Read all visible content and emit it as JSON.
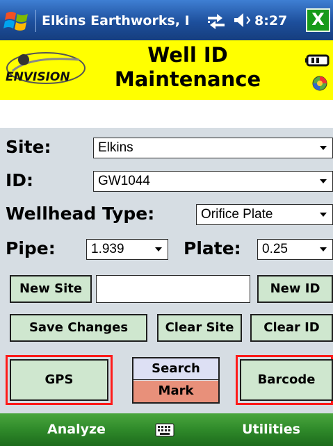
{
  "status_bar": {
    "app_title": "Elkins Earthworks, I",
    "time": "8:27",
    "close_label": "X"
  },
  "header": {
    "logo_text": "ENVISION",
    "title_line1": "Well ID",
    "title_line2": "Maintenance"
  },
  "form": {
    "site": {
      "label": "Site:",
      "value": "Elkins"
    },
    "id": {
      "label": "ID:",
      "value": "GW1044"
    },
    "wellhead_type": {
      "label": "Wellhead Type:",
      "value": "Orifice Plate"
    },
    "pipe": {
      "label": "Pipe:",
      "value": "1.939"
    },
    "plate": {
      "label": "Plate:",
      "value": "0.25"
    },
    "new_site_input": {
      "value": ""
    }
  },
  "buttons": {
    "new_site": "New Site",
    "new_id": "New ID",
    "save_changes": "Save Changes",
    "clear_site": "Clear Site",
    "clear_id": "Clear ID",
    "gps": "GPS",
    "search": "Search",
    "mark": "Mark",
    "barcode": "Barcode"
  },
  "menu": {
    "left": "Analyze",
    "right": "Utilities"
  },
  "colors": {
    "title_bar": "#1d4f9c",
    "header_bg": "#ffff00",
    "form_bg": "#d6dde3",
    "button_bg": "#cfe7cf",
    "highlight_ring": "#ff1a1a",
    "search_bg": "#dde0f4",
    "mark_bg": "#e8907a",
    "menu_bar": "#2f8a2a"
  },
  "icons": [
    "windows-start-icon",
    "network-icon",
    "volume-icon",
    "close-icon",
    "envision-logo",
    "battery-icon",
    "app-icon",
    "keyboard-icon",
    "dropdown-arrow-icon"
  ]
}
